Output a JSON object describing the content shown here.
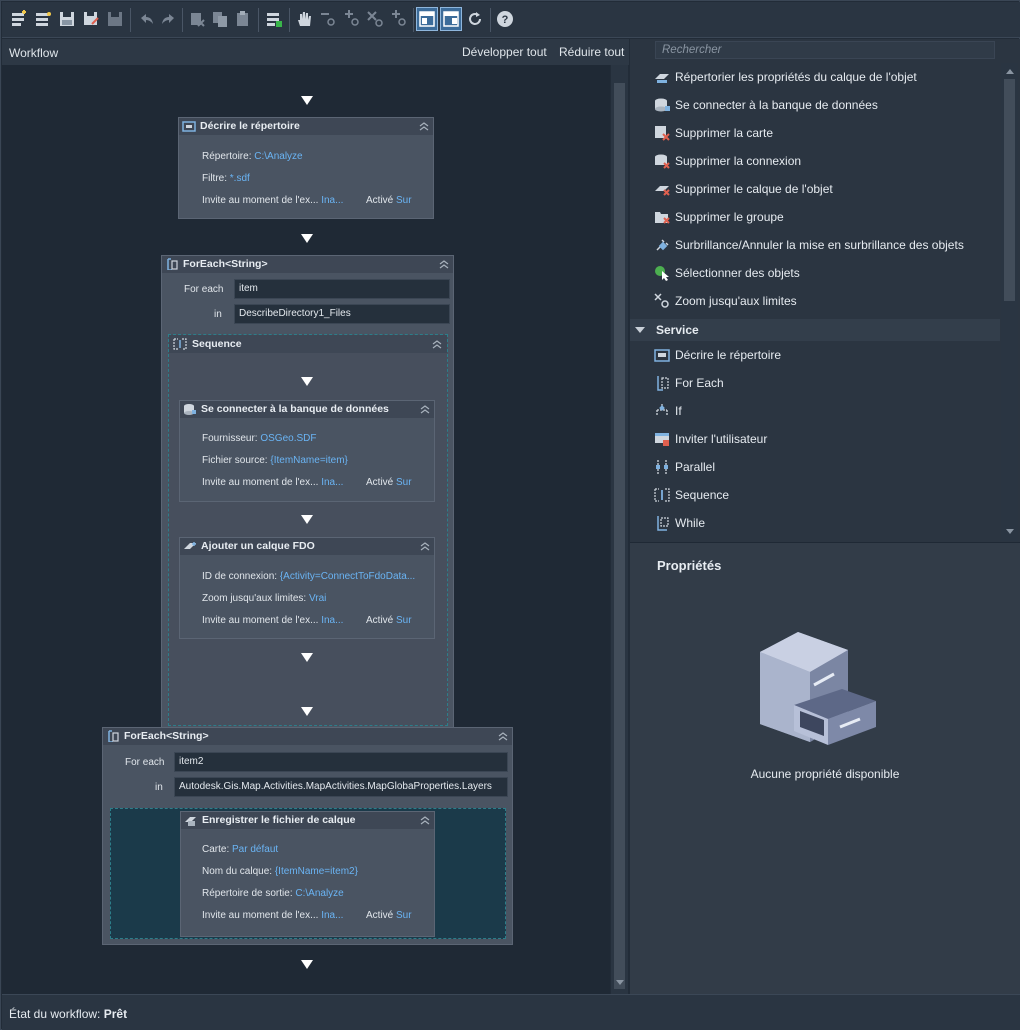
{
  "toolbar": {
    "buttons": [
      "new-workflow",
      "open-workflow",
      "save",
      "save-as",
      "disabled-save",
      "undo",
      "redo",
      "cut",
      "copy",
      "paste",
      "run",
      "pan",
      "zoom-out",
      "zoom-in",
      "zoom-extents",
      "zoom-window",
      "layout-1",
      "layout-2",
      "refresh",
      "help"
    ]
  },
  "workflow": {
    "title": "Workflow",
    "expand_all": "Développer tout",
    "collapse_all": "Réduire tout",
    "describe": {
      "title": "Décrire le répertoire",
      "dir_label": "Répertoire:",
      "dir_value": "C:\\Analyze",
      "filter_label": "Filtre:",
      "filter_value": "*.sdf",
      "prompt_label": "Invite au moment de l'ex...",
      "prompt_value": "Ina...",
      "active_label": "Activé",
      "active_value": "Sur"
    },
    "foreach1": {
      "title": "ForEach<String>",
      "for_each_label": "For each",
      "for_each_value": "item",
      "in_label": "in",
      "in_value": "DescribeDirectory1_Files",
      "sequence": {
        "title": "Sequence",
        "connect": {
          "title": "Se connecter à la banque de données",
          "provider_label": "Fournisseur:",
          "provider_value": "OSGeo.SDF",
          "source_label": "Fichier source:",
          "source_value": "{ItemName=item}",
          "prompt_label": "Invite au moment de l'ex...",
          "prompt_value": "Ina...",
          "active_label": "Activé",
          "active_value": "Sur"
        },
        "addlayer": {
          "title": "Ajouter un calque FDO",
          "conn_label": "ID de connexion:",
          "conn_value": "{Activity=ConnectToFdoData...",
          "zoom_label": "Zoom jusqu'aux limites:",
          "zoom_value": "Vrai",
          "prompt_label": "Invite au moment de l'ex...",
          "prompt_value": "Ina...",
          "active_label": "Activé",
          "active_value": "Sur"
        }
      }
    },
    "foreach2": {
      "title": "ForEach<String>",
      "for_each_label": "For each",
      "for_each_value": "item2",
      "in_label": "in",
      "in_value": "Autodesk.Gis.Map.Activities.MapActivities.MapGlobaProperties.Layers",
      "save": {
        "title": "Enregistrer le fichier de calque",
        "map_label": "Carte:",
        "map_value": "Par défaut",
        "layer_label": "Nom du calque:",
        "layer_value": "{ItemName=item2}",
        "out_label": "Répertoire de sortie:",
        "out_value": "C:\\Analyze",
        "prompt_label": "Invite au moment de l'ex...",
        "prompt_value": "Ina...",
        "active_label": "Activé",
        "active_value": "Sur"
      }
    }
  },
  "palette": {
    "search_placeholder": "Rechercher",
    "items": [
      {
        "label": "Répertorier les propriétés du calque de l'objet",
        "icon": "layer-props-icon"
      },
      {
        "label": "Se connecter à la banque de données",
        "icon": "database-connect-icon"
      },
      {
        "label": "Supprimer la carte",
        "icon": "remove-map-icon"
      },
      {
        "label": "Supprimer la connexion",
        "icon": "remove-connection-icon"
      },
      {
        "label": "Supprimer le calque de l'objet",
        "icon": "remove-layer-icon"
      },
      {
        "label": "Supprimer le groupe",
        "icon": "remove-group-icon"
      },
      {
        "label": "Surbrillance/Annuler la mise en surbrillance des objets",
        "icon": "highlight-icon"
      },
      {
        "label": "Sélectionner des objets",
        "icon": "select-objects-icon"
      },
      {
        "label": "Zoom jusqu'aux limites",
        "icon": "zoom-extents-icon"
      }
    ],
    "group": "Service",
    "service_items": [
      {
        "label": "Décrire le répertoire",
        "icon": "describe-directory-icon"
      },
      {
        "label": "For Each",
        "icon": "foreach-icon"
      },
      {
        "label": "If",
        "icon": "if-icon"
      },
      {
        "label": "Inviter l'utilisateur",
        "icon": "prompt-user-icon"
      },
      {
        "label": "Parallel",
        "icon": "parallel-icon"
      },
      {
        "label": "Sequence",
        "icon": "sequence-icon"
      },
      {
        "label": "While",
        "icon": "while-icon"
      }
    ]
  },
  "properties": {
    "title": "Propriétés",
    "empty": "Aucune propriété disponible"
  },
  "status": {
    "label": "État du workflow:",
    "value": "Prêt"
  },
  "colors": {
    "accent": "#6ab4f4",
    "panel": "#2b3541",
    "canvas": "#1f2935"
  }
}
